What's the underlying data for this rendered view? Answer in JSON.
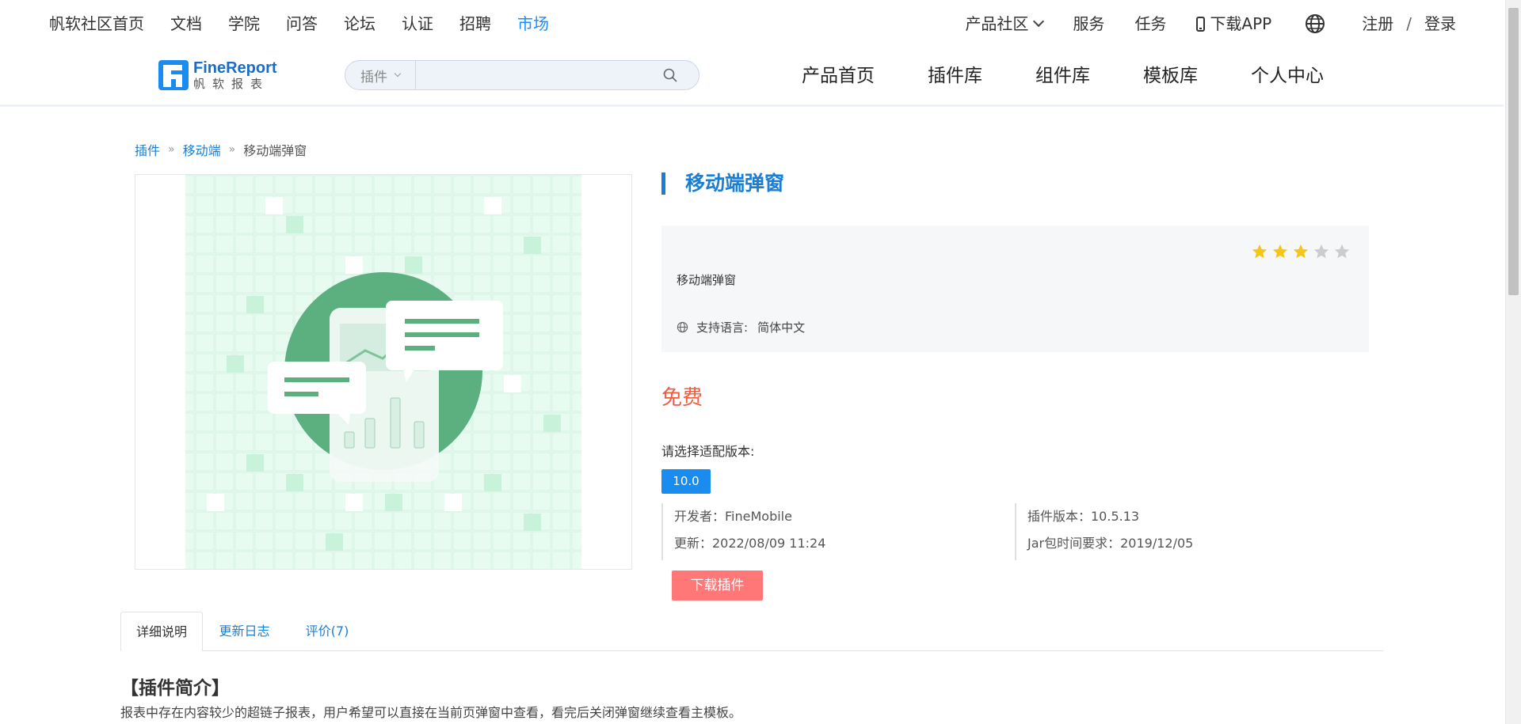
{
  "topnav": {
    "left": [
      {
        "label": "帆软社区首页",
        "active": false
      },
      {
        "label": "文档",
        "active": false
      },
      {
        "label": "学院",
        "active": false
      },
      {
        "label": "问答",
        "active": false
      },
      {
        "label": "论坛",
        "active": false
      },
      {
        "label": "认证",
        "active": false
      },
      {
        "label": "招聘",
        "active": false
      },
      {
        "label": "市场",
        "active": true
      }
    ],
    "community": "产品社区",
    "service": "服务",
    "task": "任务",
    "download_app": "下载APP",
    "register": "注册",
    "slash": "/",
    "login": "登录"
  },
  "logo": {
    "en": "FineReport",
    "cn": "帆软报表"
  },
  "search": {
    "category": "插件",
    "value": "",
    "placeholder": ""
  },
  "mainnav": [
    "产品首页",
    "插件库",
    "组件库",
    "模板库",
    "个人中心"
  ],
  "breadcrumb": {
    "items": [
      "插件",
      "移动端"
    ],
    "sep": "»",
    "current": "移动端弹窗"
  },
  "plugin": {
    "title": "移动端弹窗",
    "description": "移动端弹窗",
    "rating": 3,
    "rating_max": 5,
    "lang_label": "支持语言:",
    "lang_value": "简体中文",
    "price": "免费",
    "version_label": "请选择适配版本:",
    "version": "10.0",
    "developer": "开发者：FineMobile",
    "updated": "更新：2022/08/09 11:24",
    "plugin_version": "插件版本：10.5.13",
    "jar_requirement": "Jar包时间要求：2019/12/05",
    "download_label": "下载插件"
  },
  "tabs": [
    "详细说明",
    "更新日志",
    "评价(7)"
  ],
  "section": {
    "title": "【插件简介】",
    "intro": "报表中存在内容较少的超链子报表，用户希望可以直接在当前页弹窗中查看，看完后关闭弹窗继续查看主模板。"
  },
  "colors": {
    "accent": "#1a7fd4",
    "price": "#f25b3e",
    "download": "#ff7777",
    "star": "#f5c518",
    "star_empty": "#cccccc"
  }
}
